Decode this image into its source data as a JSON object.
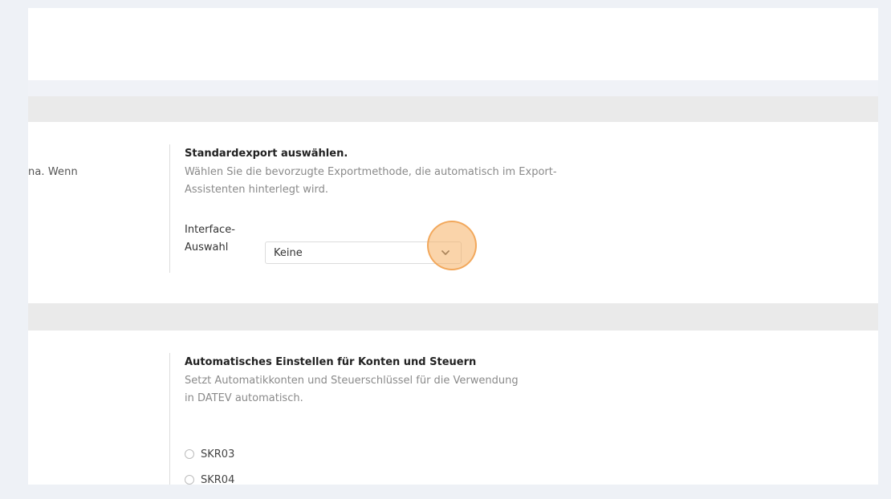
{
  "left_snippet": "na. Wenn",
  "standard_export": {
    "title": "Standardexport auswählen.",
    "description": "Wählen Sie die bevorzugte Exportmethode, die automatisch im Export-Assistenten hinterlegt wird.",
    "interface_label": "Interface-Auswahl",
    "selected_value": "Keine"
  },
  "auto_settings": {
    "title": "Automatisches Einstellen für Konten und Steuern",
    "description": "Setzt Automatikkonten und Steuerschlüssel für die Verwendung in DATEV automatisch.",
    "options": [
      "SKR03",
      "SKR04"
    ]
  },
  "icons": {
    "select_chevron": "chevron-down-icon"
  },
  "colors": {
    "highlight": "#f6b064",
    "section_header": "#eaeaea",
    "background": "#eef1f6"
  }
}
